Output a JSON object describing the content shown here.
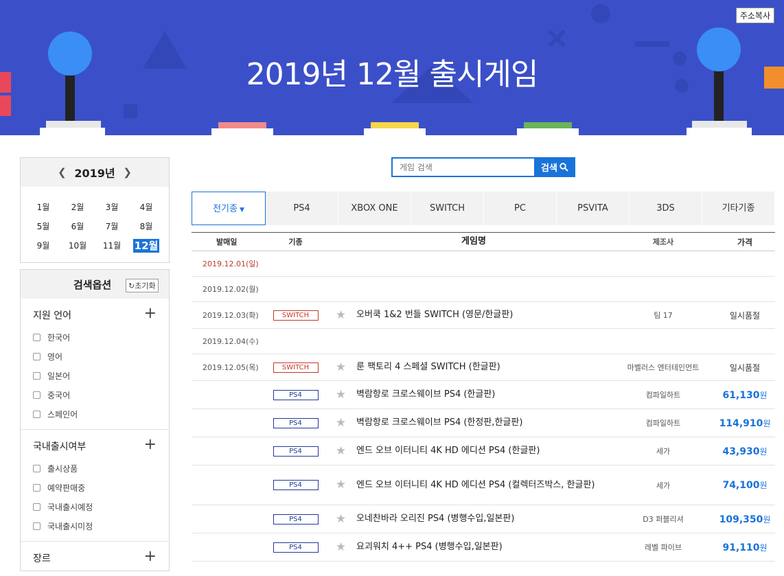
{
  "banner": {
    "title": "2019년 12월 출시게임",
    "copy_label": "주소복사"
  },
  "calendar": {
    "year": "2019년",
    "months": [
      "1월",
      "2월",
      "3월",
      "4월",
      "5월",
      "6월",
      "7월",
      "8월",
      "9월",
      "10월",
      "11월",
      "12월"
    ],
    "active_month": "12월"
  },
  "options": {
    "title": "검색옵션",
    "reset_label": "초기화",
    "sections": [
      {
        "title": "지원 언어",
        "items": [
          "한국어",
          "영어",
          "일본어",
          "중국어",
          "스페인어"
        ]
      },
      {
        "title": "국내출시여부",
        "items": [
          "출시상품",
          "예약판매중",
          "국내출시예정",
          "국내출시미정"
        ]
      },
      {
        "title": "장르",
        "items": []
      }
    ]
  },
  "search": {
    "placeholder": "게임 검색",
    "button_label": "검색"
  },
  "tabs": [
    {
      "label": "전기종",
      "active": true
    },
    {
      "label": "PS4"
    },
    {
      "label": "XBOX ONE"
    },
    {
      "label": "SWITCH"
    },
    {
      "label": "PC"
    },
    {
      "label": "PSVITA"
    },
    {
      "label": "3DS"
    },
    {
      "label": "기타기종"
    }
  ],
  "table": {
    "headers": {
      "date": "발매일",
      "platform": "기종",
      "name": "게임명",
      "maker": "제조사",
      "price": "가격"
    },
    "rows": [
      {
        "date": "2019.12.01(일)",
        "red": true
      },
      {
        "date": "2019.12.02(월)"
      },
      {
        "date": "2019.12.03(화)",
        "platform": "SWITCH",
        "name": "오버쿡 1&2 번들 SWITCH (영문/한글판)",
        "maker": "팀 17",
        "price_text": "일시품절"
      },
      {
        "date": "2019.12.04(수)"
      },
      {
        "date": "2019.12.05(목)",
        "platform": "SWITCH",
        "name": "룬 팩토리 4 스페셜 SWITCH (한글판)",
        "maker": "마벨러스 엔터테인먼트",
        "price_text": "일시품절"
      },
      {
        "platform": "PS4",
        "name": "벽람항로 크로스웨이브 PS4 (한글판)",
        "maker": "컴파일하트",
        "price": "61,130",
        "unit": "원"
      },
      {
        "platform": "PS4",
        "name": "벽람항로 크로스웨이브 PS4 (한정판,한글판)",
        "maker": "컴파일하트",
        "price": "114,910",
        "unit": "원"
      },
      {
        "platform": "PS4",
        "name": "엔드 오브 이터니티 4K HD 에디션 PS4 (한글판)",
        "maker": "세가",
        "price": "43,930",
        "unit": "원"
      },
      {
        "platform": "PS4",
        "name": "엔드 오브 이터니티 4K HD 에디션 PS4 (컬렉터즈박스, 한글판)",
        "maker": "세가",
        "price": "74,100",
        "unit": "원",
        "tall": true
      },
      {
        "platform": "PS4",
        "name": "오네찬바라 오리진 PS4 (병행수입,일본판)",
        "maker": "D3 퍼블리셔",
        "price": "109,350",
        "unit": "원"
      },
      {
        "platform": "PS4",
        "name": "요괴워치 4++ PS4 (병행수입,일본판)",
        "maker": "레벨 파이브",
        "price": "91,110",
        "unit": "원"
      }
    ]
  },
  "colors": {
    "banner": "#3b50c8",
    "accent": "#1a73d9",
    "switch": "#c0392b",
    "ps4": "#1f3a93"
  }
}
